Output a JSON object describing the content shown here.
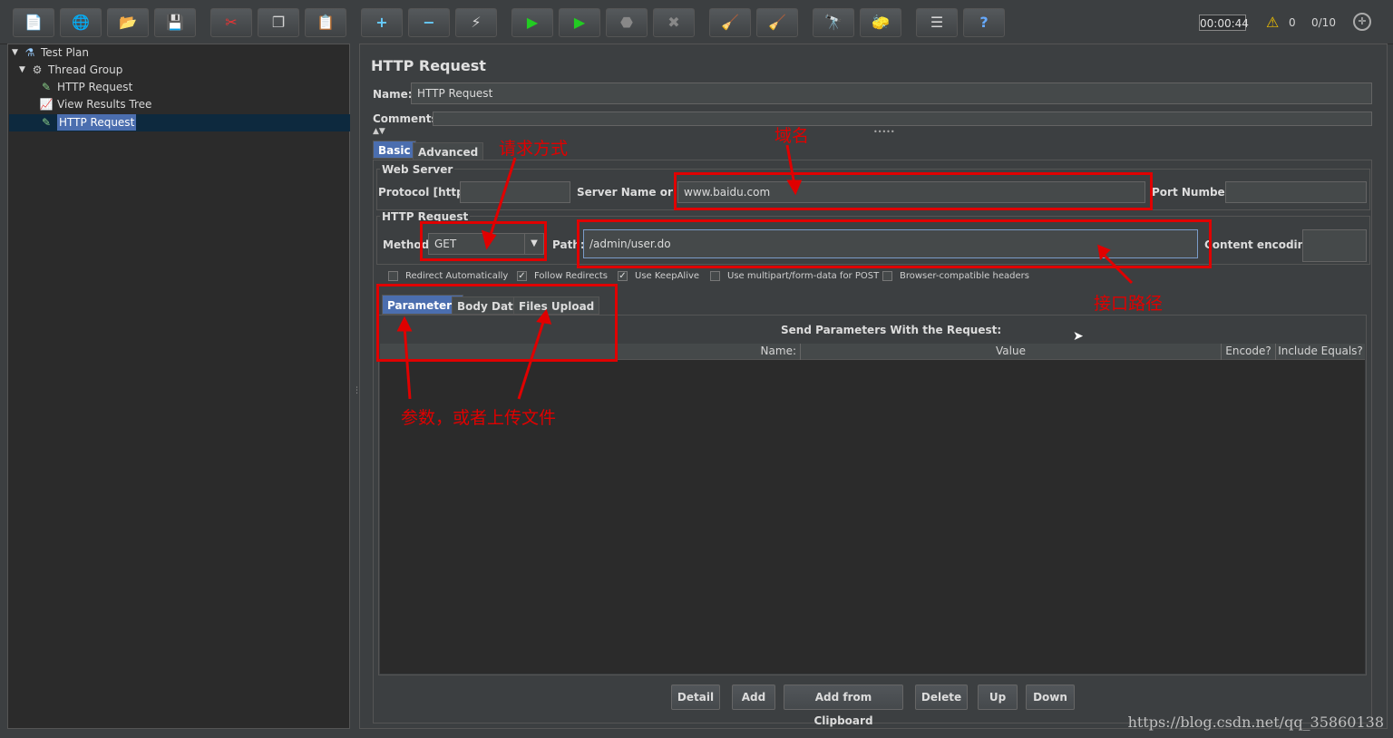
{
  "toolbar": {
    "icons": [
      "new-icon",
      "templates-icon",
      "open-icon",
      "save-icon",
      "cut-icon",
      "copy-icon",
      "paste-icon",
      "expand-icon",
      "collapse-icon",
      "toggle-icon",
      "start-icon",
      "start-no-timers-icon",
      "stop-icon",
      "shutdown-icon",
      "clear-icon",
      "clear-all-icon",
      "search-icon",
      "reset-search-icon",
      "function-helper-icon",
      "help-icon"
    ],
    "timer": "00:00:44",
    "warnings": "0",
    "threads": "0/10"
  },
  "tree": {
    "items": [
      {
        "label": "Test Plan",
        "icon": "test-plan-icon"
      },
      {
        "label": "Thread Group",
        "icon": "thread-group-icon"
      },
      {
        "label": "HTTP Request",
        "icon": "sampler-icon"
      },
      {
        "label": "View Results Tree",
        "icon": "listener-icon"
      },
      {
        "label": "HTTP Request",
        "icon": "sampler-icon"
      }
    ]
  },
  "panel": {
    "title": "HTTP Request",
    "name_label": "Name:",
    "name_value": "HTTP Request",
    "comments_label": "Comments:",
    "tabs": {
      "basic": "Basic",
      "advanced": "Advanced"
    },
    "web_server": {
      "legend": "Web Server",
      "protocol_label": "Protocol [http]:",
      "protocol_value": "",
      "server_label": "Server Name or IP:",
      "server_value": "www.baidu.com",
      "port_label": "Port Number:",
      "port_value": ""
    },
    "http_request": {
      "legend": "HTTP Request",
      "method_label": "Method",
      "method_value": "GET",
      "path_label": "Path:",
      "path_value": "/admin/user.do",
      "encoding_label": "Content encoding:",
      "encoding_value": ""
    },
    "checkboxes": [
      {
        "label": "Redirect Automatically",
        "checked": false
      },
      {
        "label": "Follow Redirects",
        "checked": true
      },
      {
        "label": "Use KeepAlive",
        "checked": true
      },
      {
        "label": "Use multipart/form-data for POST",
        "checked": false
      },
      {
        "label": "Browser-compatible headers",
        "checked": false
      }
    ],
    "subtabs": {
      "parameters": "Parameters",
      "body": "Body Data",
      "files": "Files Upload"
    },
    "params_title": "Send Parameters With the Request:",
    "columns": {
      "name": "Name:",
      "value": "Value",
      "encode": "Encode?",
      "include": "Include Equals?"
    },
    "buttons": {
      "detail": "Detail",
      "add": "Add",
      "add_clipboard": "Add from Clipboard",
      "delete": "Delete",
      "up": "Up",
      "down": "Down"
    }
  },
  "annotations": {
    "method": "请求方式",
    "domain": "域名",
    "path": "接口路径",
    "params": "参数，或者上传文件"
  },
  "colors": {
    "annotation": "#e00000",
    "selection": "#4b6eaf"
  },
  "watermark": "https://blog.csdn.net/qq_35860138"
}
